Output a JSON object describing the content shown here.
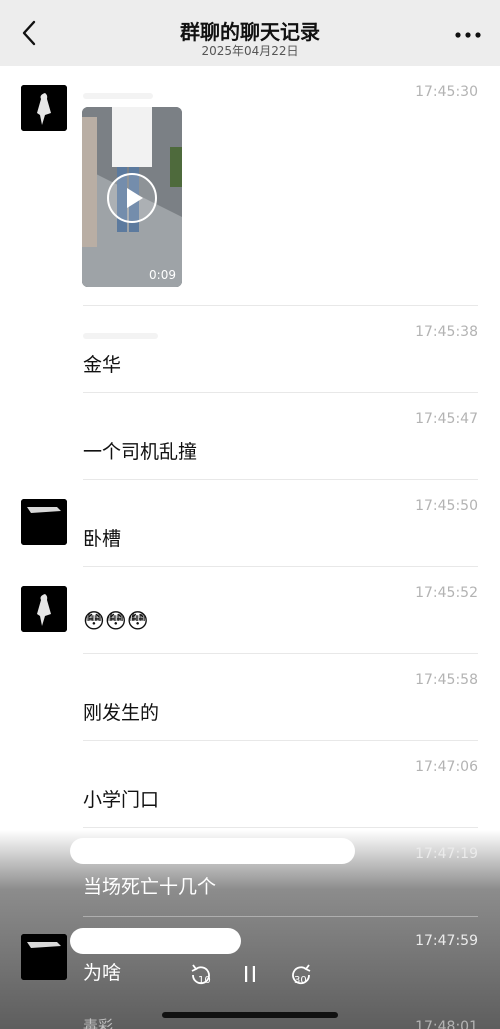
{
  "header": {
    "title": "群聊的聊天记录",
    "date": "2025年04月22日"
  },
  "messages": [
    {
      "time": "17:45:30",
      "type": "video",
      "duration": "0:09"
    },
    {
      "time": "17:45:38",
      "text": "金华"
    },
    {
      "time": "17:45:47",
      "text": "一个司机乱撞"
    },
    {
      "time": "17:45:50",
      "text": "卧槽"
    },
    {
      "time": "17:45:52",
      "type": "emoji",
      "emoji": "😳😳😳"
    },
    {
      "time": "17:45:58",
      "text": "刚发生的"
    },
    {
      "time": "17:47:06",
      "text": "小学门口"
    },
    {
      "time": "17:47:19",
      "text": "当场死亡十几个"
    },
    {
      "time": "17:47:59",
      "text": "为啥"
    },
    {
      "time": "17:48:01",
      "partial_name": "毒彩"
    }
  ],
  "player": {
    "rewind_label": "10",
    "forward_label": "30"
  },
  "icons": {
    "back": "chevron-left-icon",
    "more": "more-dots-icon",
    "play": "play-icon",
    "rewind": "rewind-10-icon",
    "pause": "pause-icon",
    "forward": "forward-30-icon"
  }
}
